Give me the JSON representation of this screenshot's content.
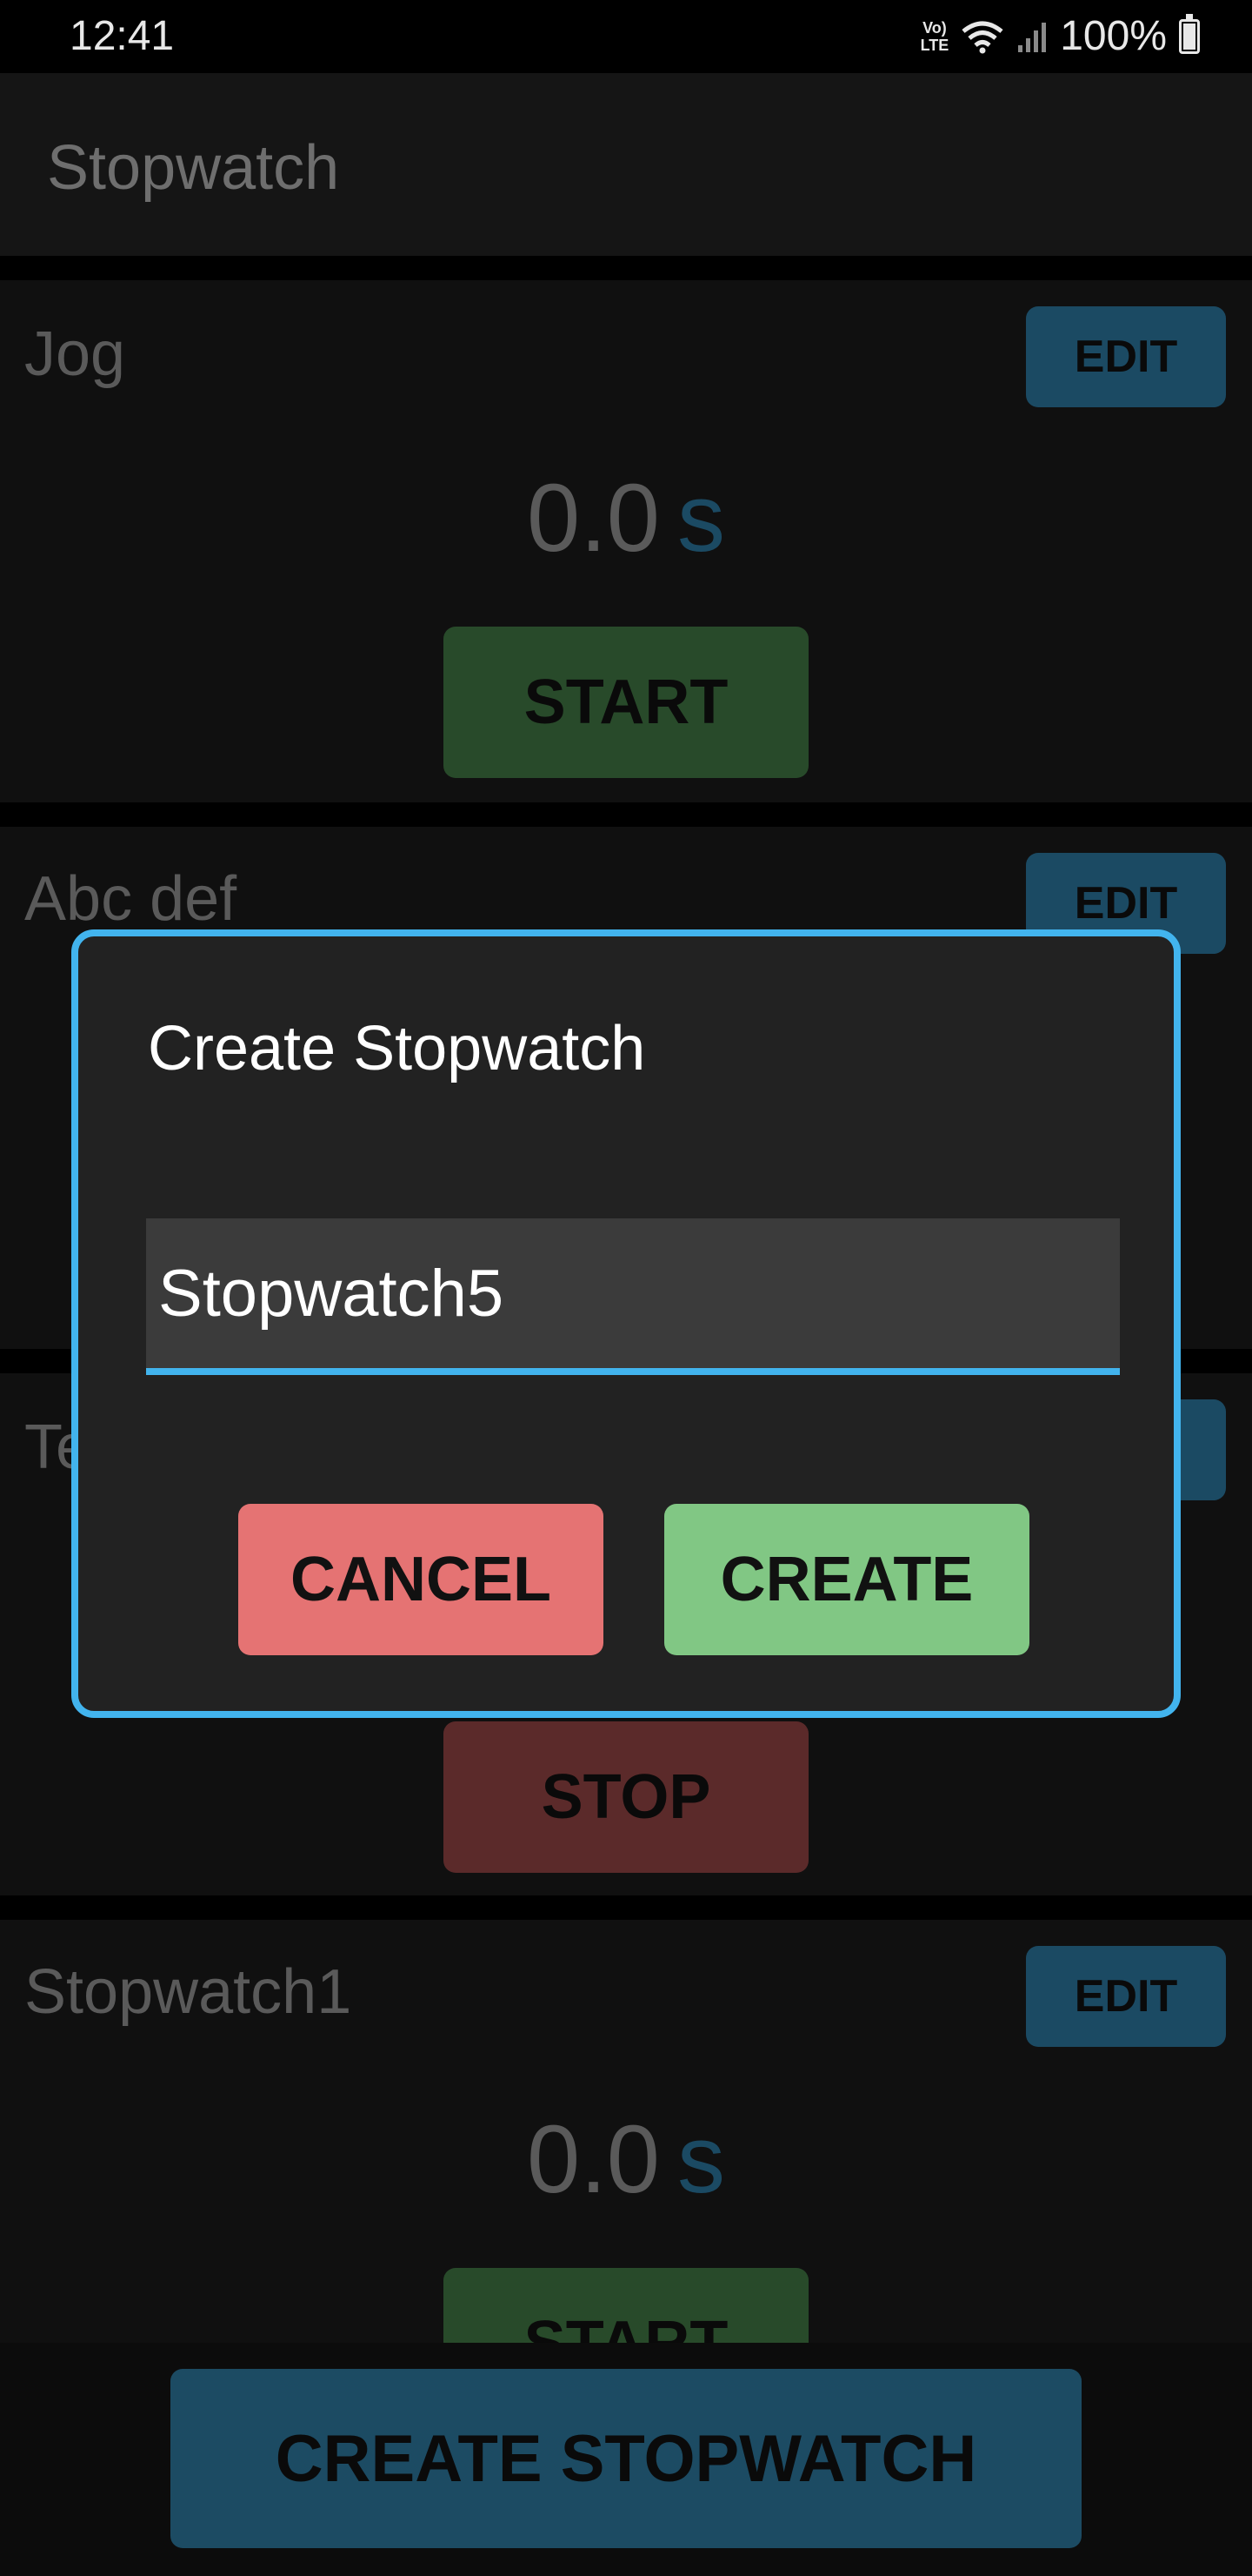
{
  "status_bar": {
    "time": "12:41",
    "network_label_top": "Vo)",
    "network_label_bottom": "LTE",
    "battery": "100%"
  },
  "app_bar": {
    "title": "Stopwatch"
  },
  "stopwatches": [
    {
      "name": "Jog",
      "edit_label": "EDIT",
      "time": "0.0",
      "unit": "s",
      "action_label": "START"
    },
    {
      "name": "Abc def",
      "edit_label": "EDIT"
    },
    {
      "name": "Te",
      "action_label": "STOP"
    },
    {
      "name": "Stopwatch1",
      "edit_label": "EDIT",
      "time": "0.0",
      "unit": "s",
      "action_label": "START"
    }
  ],
  "bottom_bar": {
    "create_label": "CREATE STOPWATCH"
  },
  "dialog": {
    "title": "Create Stopwatch",
    "input_value": "Stopwatch5",
    "cancel_label": "CANCEL",
    "create_label": "CREATE"
  },
  "colors": {
    "accent": "#42b4ee",
    "cancel": "#e57373",
    "create": "#81c784",
    "edit": "#1b4a63"
  }
}
